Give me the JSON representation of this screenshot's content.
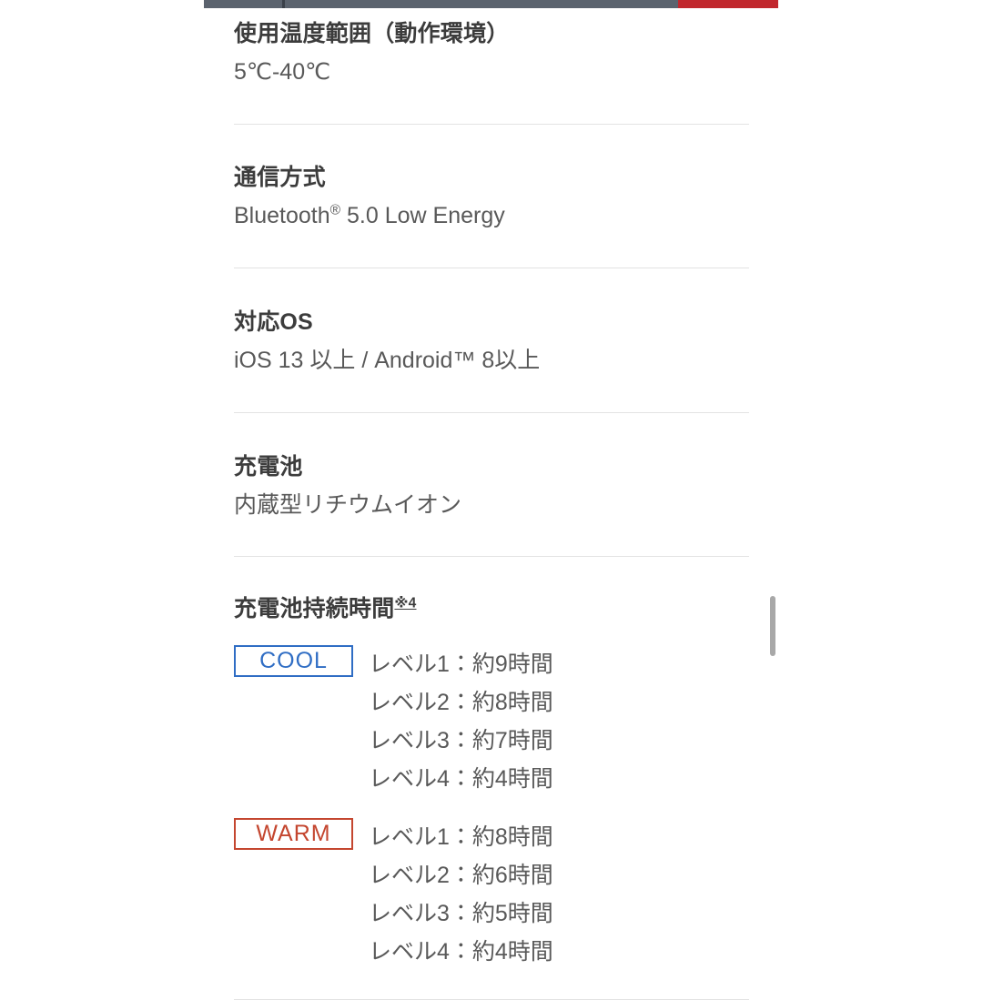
{
  "topbar": {
    "segments": [
      {
        "name": "progress-gray-left",
        "color": "#5b636e"
      },
      {
        "name": "progress-divider",
        "color": "#3a4049"
      },
      {
        "name": "progress-gray-right",
        "color": "#5b636e"
      },
      {
        "name": "progress-red",
        "color": "#c1272d"
      }
    ]
  },
  "specs": [
    {
      "title": "使用温度範囲（動作環境）",
      "value": "5℃-40℃"
    },
    {
      "title": "通信方式",
      "value_prefix": "Bluetooth",
      "value_sup": "®",
      "value_suffix": " 5.0 Low Energy"
    },
    {
      "title": "対応OS",
      "value": "iOS 13 以上 / Android™ 8以上"
    },
    {
      "title": "充電池",
      "value": "内蔵型リチウムイオン"
    }
  ],
  "battery_duration": {
    "title": "充電池持続時間",
    "footnote_marker": "※4",
    "modes": [
      {
        "badge": "COOL",
        "badge_color": "#2f6dc4",
        "levels": [
          "レベル1：約9時間",
          "レベル2：約8時間",
          "レベル3：約7時間",
          "レベル4：約4時間"
        ]
      },
      {
        "badge": "WARM",
        "badge_color": "#c4462f",
        "levels": [
          "レベル1：約8時間",
          "レベル2：約6時間",
          "レベル3：約5時間",
          "レベル4：約4時間"
        ]
      }
    ]
  }
}
